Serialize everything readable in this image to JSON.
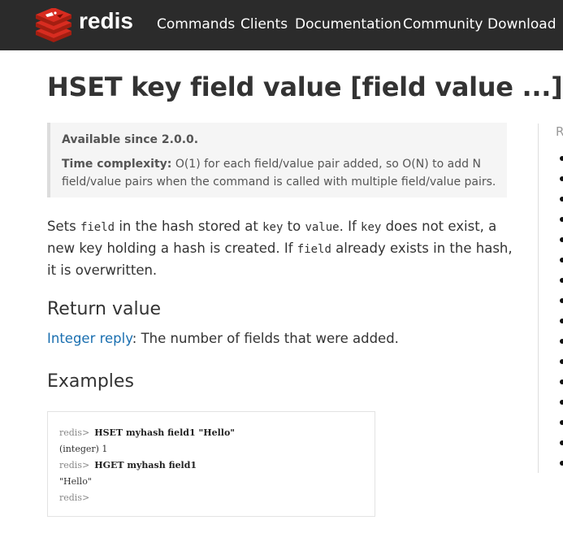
{
  "brand": {
    "name": "redis"
  },
  "nav": {
    "items": [
      {
        "label": "Commands"
      },
      {
        "label": "Clients"
      },
      {
        "label": "Documentation"
      },
      {
        "label": "Community"
      },
      {
        "label": "Download"
      }
    ]
  },
  "command": {
    "title": "HSET key field value [field value ...]",
    "available_since": "Available since 2.0.0.",
    "time_complexity_label": "Time complexity:",
    "time_complexity_text": "O(1) for each field/value pair added, so O(N) to add N field/value pairs when the command is called with multiple field/value pairs."
  },
  "description": {
    "t1": "Sets ",
    "code1": "field",
    "t2": " in the hash stored at ",
    "code2": "key",
    "t3": " to ",
    "code3": "value",
    "t4": ". If ",
    "code4": "key",
    "t5": " does not exist, a new key holding a hash is created. If ",
    "code5": "field",
    "t6": " already exists in the hash, it is overwritten."
  },
  "return_value": {
    "heading": "Return value",
    "link": "Integer reply",
    "text": ": The number of fields that were added."
  },
  "examples": {
    "heading": "Examples",
    "lines": [
      {
        "prompt": "redis>",
        "text": "HSET myhash field1 \"Hello\""
      },
      {
        "prompt": "",
        "text": "(integer) 1"
      },
      {
        "prompt": "redis>",
        "text": "HGET myhash field1"
      },
      {
        "prompt": "",
        "text": "\"Hello\""
      },
      {
        "prompt": "redis>",
        "text": ""
      }
    ]
  },
  "sidebar": {
    "heading_fragment": "R",
    "bullet_count": 16
  },
  "colors": {
    "topbar": "#2b2b2b",
    "link": "#1a6fb0",
    "logo_red": "#d82c20"
  }
}
